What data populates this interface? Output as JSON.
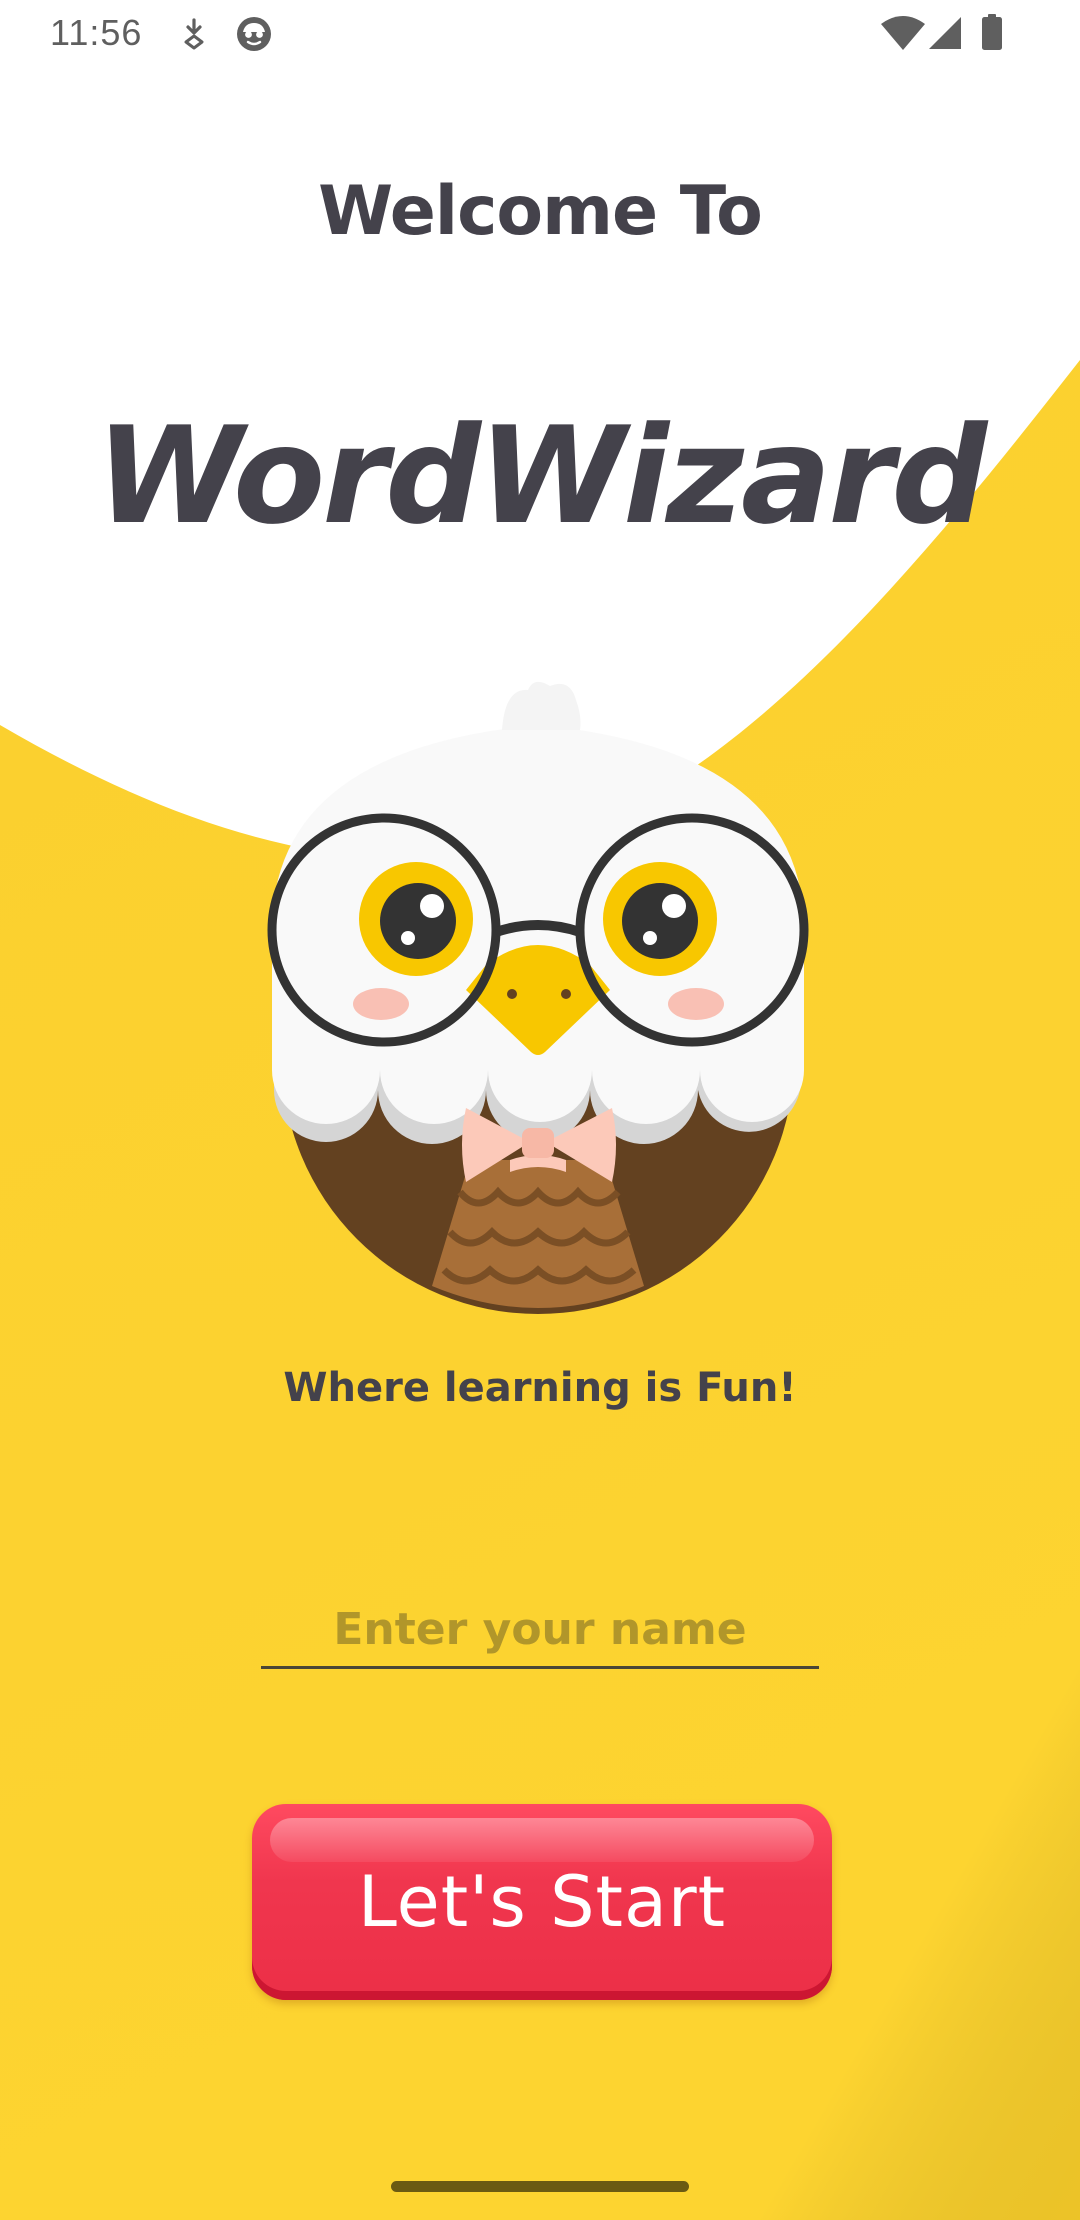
{
  "status_bar": {
    "time": "11:56",
    "icons": [
      "download-notify-icon",
      "face-notify-icon",
      "wifi-icon",
      "cell-signal-icon",
      "battery-icon"
    ]
  },
  "welcome": {
    "heading": "Welcome To",
    "app_title": "WordWizard",
    "tagline": "Where learning is Fun!"
  },
  "name_input": {
    "value": "",
    "placeholder": "Enter your name"
  },
  "start_button": {
    "label": "Let's Start"
  },
  "colors": {
    "background_top": "#ffffff",
    "background_yellow": "#fdd430",
    "text_dark": "#44424b",
    "placeholder": "#b1962a",
    "button_red": "#ef344c"
  },
  "mascot": {
    "icon": "owl-mascot-icon"
  }
}
